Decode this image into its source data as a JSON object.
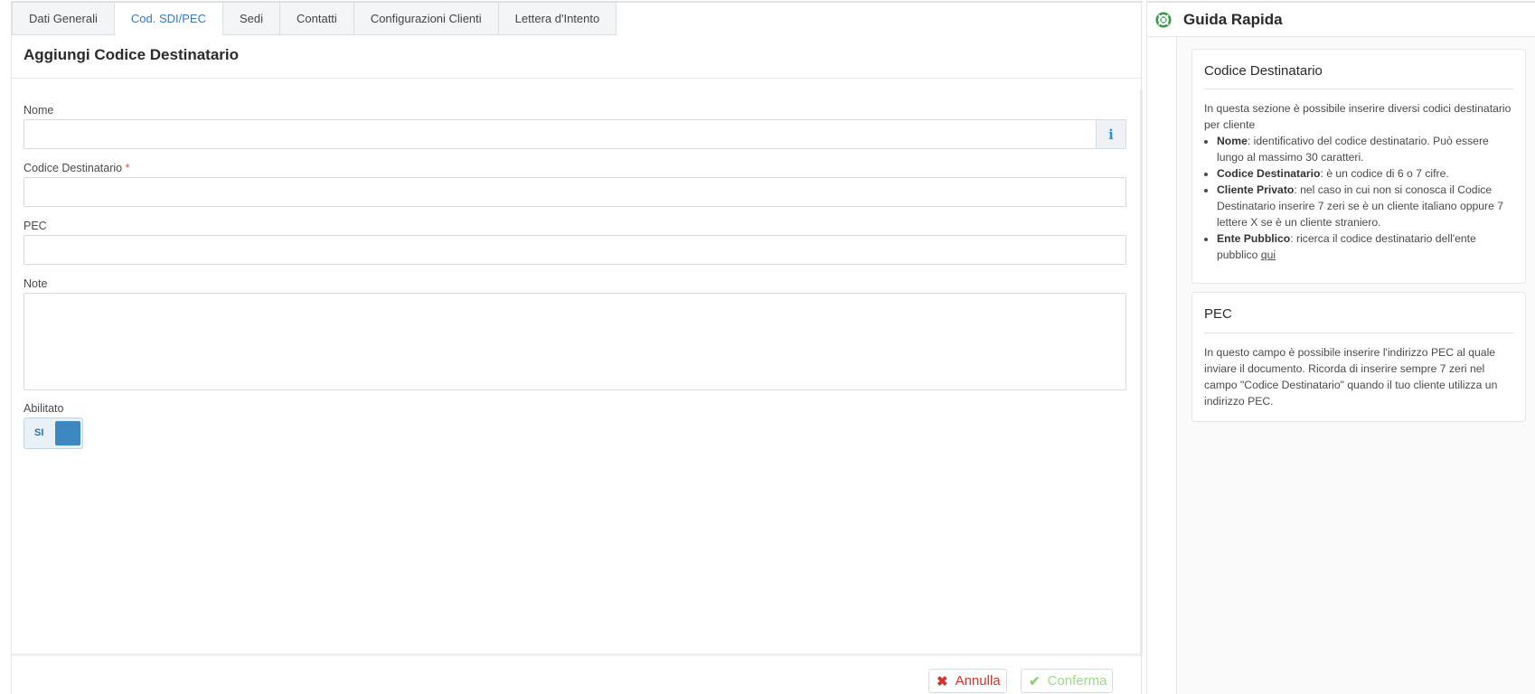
{
  "tabs": [
    {
      "label": "Dati Generali",
      "active": false
    },
    {
      "label": "Cod. SDI/PEC",
      "active": true
    },
    {
      "label": "Sedi",
      "active": false
    },
    {
      "label": "Contatti",
      "active": false
    },
    {
      "label": "Configurazioni Clienti",
      "active": false
    },
    {
      "label": "Lettera d'Intento",
      "active": false
    }
  ],
  "form": {
    "title": "Aggiungi Codice Destinatario",
    "nome": {
      "label": "Nome",
      "value": "",
      "info_icon": "info-icon"
    },
    "codice": {
      "label": "Codice Destinatario",
      "required_mark": "*",
      "value": ""
    },
    "pec": {
      "label": "PEC",
      "value": ""
    },
    "note": {
      "label": "Note",
      "value": ""
    },
    "abilitato": {
      "label": "Abilitato",
      "toggle_text": "SI",
      "on": true
    }
  },
  "footer": {
    "cancel_label": "Annulla",
    "cancel_icon": "x-icon",
    "confirm_label": "Conferma",
    "confirm_icon": "check-icon"
  },
  "guide": {
    "title": "Guida Rapida",
    "icon": "lifebuoy-icon",
    "cards": [
      {
        "title": "Codice Destinatario",
        "intro": "In questa sezione è possibile inserire diversi codici destinatario per cliente",
        "items": [
          {
            "term": "Nome",
            "text": ": identificativo del codice destinatario. Può essere lungo al massimo 30 caratteri."
          },
          {
            "term": "Codice Destinatario",
            "text": ": è un codice di 6 o 7 cifre."
          },
          {
            "term": "Cliente Privato",
            "text": ": nel caso in cui non si conosca il Codice Destinatario inserire 7 zeri se è un cliente italiano oppure 7 lettere X se è un cliente straniero."
          },
          {
            "term": "Ente Pubblico",
            "text": ": ricerca il codice destinatario dell'ente pubblico ",
            "link": "qui"
          }
        ]
      },
      {
        "title": "PEC",
        "body": "In questo campo è possibile inserire l'indirizzo PEC al quale inviare il documento. Ricorda di inserire sempre 7 zeri nel campo \"Codice Destinatario\" quando il tuo cliente utilizza un indirizzo PEC."
      }
    ]
  },
  "colors": {
    "accent": "#3a79b9",
    "toggle_on": "#3d88c0",
    "cancel": "#d6322b",
    "confirm": "#9fd98a",
    "required": "#d9534f",
    "info": "#2a97d4"
  }
}
